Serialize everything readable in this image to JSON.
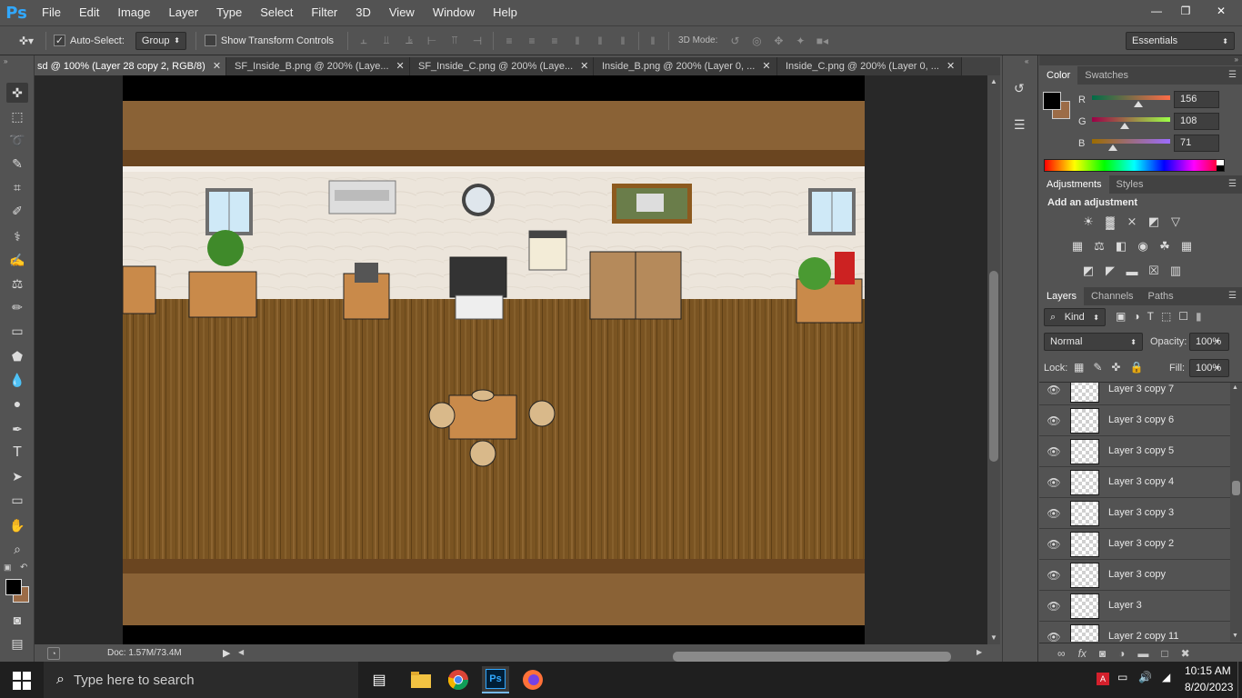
{
  "app": {
    "logo": "Ps",
    "menu": [
      "File",
      "Edit",
      "Image",
      "Layer",
      "Type",
      "Select",
      "Filter",
      "3D",
      "View",
      "Window",
      "Help"
    ]
  },
  "options": {
    "auto_select_label": "Auto-Select:",
    "auto_select_checked": true,
    "auto_select_value": "Group",
    "show_transform_label": "Show Transform Controls",
    "mode_3d_label": "3D Mode:",
    "workspace": "Essentials"
  },
  "tabs": [
    {
      "label": "sd @ 100% (Layer 28 copy 2, RGB/8)",
      "active": true
    },
    {
      "label": "SF_Inside_B.png @ 200% (Laye...",
      "active": false
    },
    {
      "label": "SF_Inside_C.png @ 200% (Laye...",
      "active": false
    },
    {
      "label": "Inside_B.png @ 200% (Layer 0, ...",
      "active": false
    },
    {
      "label": "Inside_C.png @ 200% (Layer 0, ...",
      "active": false
    }
  ],
  "status": {
    "doc": "Doc: 1.57M/73.4M"
  },
  "color_panel": {
    "tabs": [
      "Color",
      "Swatches"
    ],
    "r_label": "R",
    "g_label": "G",
    "b_label": "B",
    "r": "156",
    "g": "108",
    "b": "71",
    "fg_color": "#000000",
    "bg_color": "#9c6c47"
  },
  "adjustments_panel": {
    "tabs": [
      "Adjustments",
      "Styles"
    ],
    "heading": "Add an adjustment"
  },
  "layers_panel": {
    "tabs": [
      "Layers",
      "Channels",
      "Paths"
    ],
    "filter": "Kind",
    "blend": "Normal",
    "opacity_label": "Opacity:",
    "opacity": "100%",
    "lock_label": "Lock:",
    "fill_label": "Fill:",
    "fill": "100%",
    "layers": [
      "Layer 3 copy 7",
      "Layer 3 copy 6",
      "Layer 3 copy 5",
      "Layer 3 copy 4",
      "Layer 3 copy 3",
      "Layer 3 copy 2",
      "Layer 3 copy",
      "Layer 3",
      "Layer 2 copy 11"
    ]
  },
  "taskbar": {
    "search_placeholder": "Type here to search",
    "time": "10:15 AM",
    "date": "8/20/2023"
  }
}
